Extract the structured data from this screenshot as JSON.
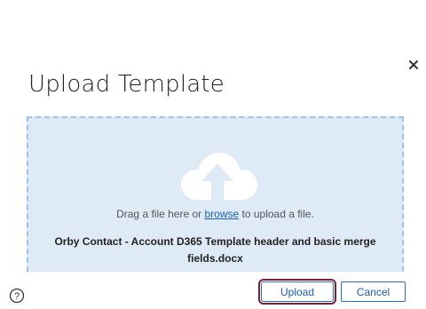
{
  "dialog": {
    "title": "Upload Template",
    "close_icon": "close-icon"
  },
  "dropzone": {
    "icon": "cloud-upload-icon",
    "drag_text_before": "Drag a file here or ",
    "browse_link": "browse",
    "drag_text_after": " to upload a file.",
    "file_name": "Orby Contact - Account D365 Template header and basic merge fields.docx"
  },
  "footer": {
    "help_icon": "help-icon",
    "upload_label": "Upload",
    "cancel_label": "Cancel"
  },
  "colors": {
    "dropzone_bg": "#dfeaf7",
    "dropzone_border": "#9ec3ea",
    "link": "#1a5fb4",
    "focus_ring": "#7b1e3a"
  }
}
